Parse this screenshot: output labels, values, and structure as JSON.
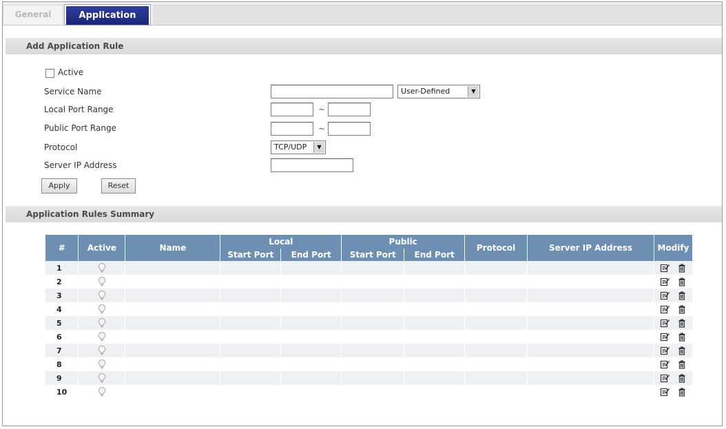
{
  "tabs": [
    {
      "label": "General",
      "active": false
    },
    {
      "label": "Application",
      "active": true
    }
  ],
  "add_section": {
    "title": "Add Application Rule",
    "active_label": "Active",
    "active_checked": false,
    "service_name_label": "Service Name",
    "service_name_value": "",
    "service_select_value": "User-Defined",
    "local_port_label": "Local Port Range",
    "public_port_label": "Public Port Range",
    "range_sep": "~",
    "protocol_label": "Protocol",
    "protocol_value": "TCP/UDP",
    "server_ip_label": "Server IP Address",
    "apply_label": "Apply",
    "reset_label": "Reset"
  },
  "summary_section": {
    "title": "Application Rules Summary",
    "headers": {
      "num": "#",
      "active": "Active",
      "name": "Name",
      "local": "Local",
      "public": "Public",
      "start_port": "Start Port",
      "end_port": "End Port",
      "protocol": "Protocol",
      "server_ip": "Server IP Address",
      "modify": "Modify"
    },
    "rows": [
      {
        "num": "1"
      },
      {
        "num": "2"
      },
      {
        "num": "3"
      },
      {
        "num": "4"
      },
      {
        "num": "5"
      },
      {
        "num": "6"
      },
      {
        "num": "7"
      },
      {
        "num": "8"
      },
      {
        "num": "9"
      },
      {
        "num": "10"
      }
    ]
  },
  "icons": {
    "active_indicator": "lightbulb-icon",
    "edit": "edit-icon",
    "delete": "trash-icon"
  },
  "colors": {
    "tab_active": "#1c2778",
    "table_header": "#6d8fb4",
    "row_alt": "#eef0f4"
  }
}
